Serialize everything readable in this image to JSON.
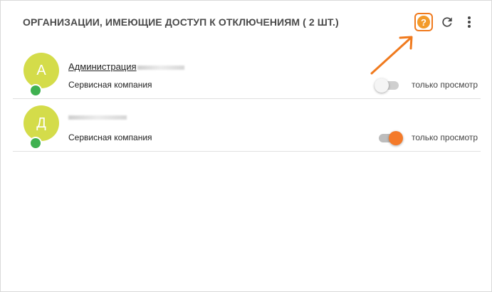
{
  "header": {
    "title": "ОРГАНИЗАЦИИ, ИМЕЮЩИЕ ДОСТУП К ОТКЛЮЧЕНИЯМ ( 2 ШТ.)",
    "help_icon": "?",
    "refresh_icon": "refresh-icon",
    "more_icon": "more-vertical-icon",
    "accent": "#f07a1e"
  },
  "organizations": [
    {
      "initial": "А",
      "name": "Администрация",
      "type": "Сервисная компания",
      "toggle_on": false,
      "toggle_label": "только просмотр",
      "status_color": "#3fb150"
    },
    {
      "initial": "Д",
      "name": "",
      "type": "Сервисная компания",
      "toggle_on": true,
      "toggle_label": "только просмотр",
      "status_color": "#3fb150"
    }
  ]
}
